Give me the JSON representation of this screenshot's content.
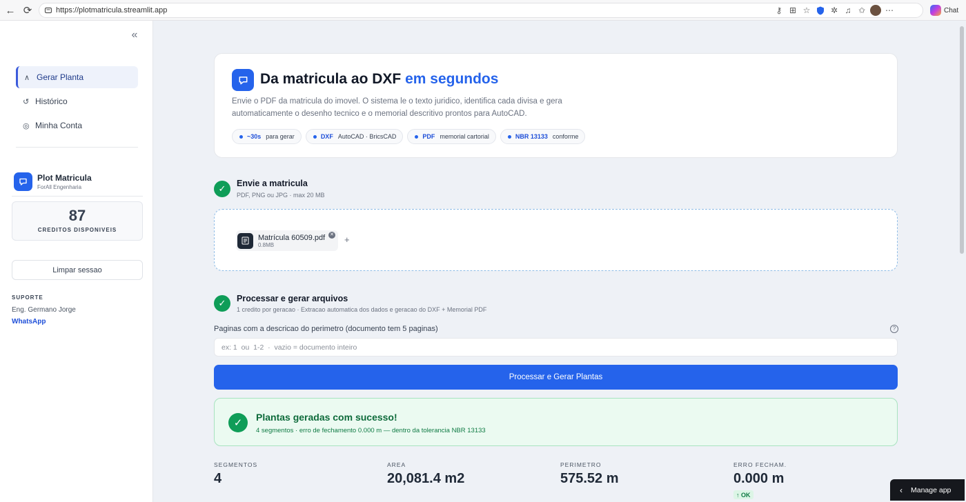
{
  "browser": {
    "url": "https://plotmatricula.streamlit.app",
    "chat_label": "Chat"
  },
  "sidebar": {
    "nav": [
      {
        "label": "Gerar Planta",
        "icon": "caret-up-icon",
        "active": true
      },
      {
        "label": "Histórico",
        "icon": "history-icon",
        "active": false
      },
      {
        "label": "Minha Conta",
        "icon": "user-circle-icon",
        "active": false
      }
    ],
    "brand": {
      "title": "Plot Matricula",
      "subtitle": "ForAll Engenharia"
    },
    "credits": {
      "value": "87",
      "label": "CREDITOS DISPONIVEIS"
    },
    "clear_label": "Limpar sessao",
    "support": {
      "heading": "SUPORTE",
      "name": "Eng. Germano Jorge",
      "link": "WhatsApp"
    }
  },
  "hero": {
    "title": "Da matricula ao DXF",
    "title_accent": "em segundos",
    "description": "Envie o PDF da matricula do imovel. O sistema le o texto juridico, identifica cada divisa e gera automaticamente o desenho tecnico e o memorial descritivo prontos para AutoCAD.",
    "pills": [
      {
        "key": "~30s",
        "value": "para gerar"
      },
      {
        "key": "DXF",
        "value": "AutoCAD · BricsCAD"
      },
      {
        "key": "PDF",
        "value": "memorial cartorial"
      },
      {
        "key": "NBR 13133",
        "value": "conforme"
      }
    ]
  },
  "upload": {
    "title": "Envie a matricula",
    "subtitle": "PDF, PNG ou JPG · max 20 MB",
    "file_name": "Matrícula 60509.pdf",
    "file_size": "0.8MB",
    "add_label": "+"
  },
  "process": {
    "title": "Processar e gerar arquivos",
    "subtitle": "1 credito por geracao · Extracao automatica dos dados e geracao do DXF + Memorial PDF",
    "pages_label": "Paginas com a descricao do perimetro (documento tem 5 paginas)",
    "pages_placeholder": "ex: 1  ou  1-2  ·  vazio = documento inteiro",
    "pages_value": "",
    "button_label": "Processar e Gerar Plantas"
  },
  "success": {
    "title": "Plantas geradas com sucesso!",
    "subtitle": "4 segmentos · erro de fechamento 0.000 m — dentro da tolerancia NBR 13133"
  },
  "metrics": [
    {
      "label": "SEGMENTOS",
      "value": "4"
    },
    {
      "label": "AREA",
      "value": "20,081.4 m2"
    },
    {
      "label": "PERIMETRO",
      "value": "575.52 m"
    },
    {
      "label": "ERRO FECHAM.",
      "value": "0.000 m"
    }
  ],
  "closure_badge": "↑ OK",
  "manage_app": "Manage app",
  "colors": {
    "accent": "#2563eb",
    "success": "#0f9d58"
  }
}
